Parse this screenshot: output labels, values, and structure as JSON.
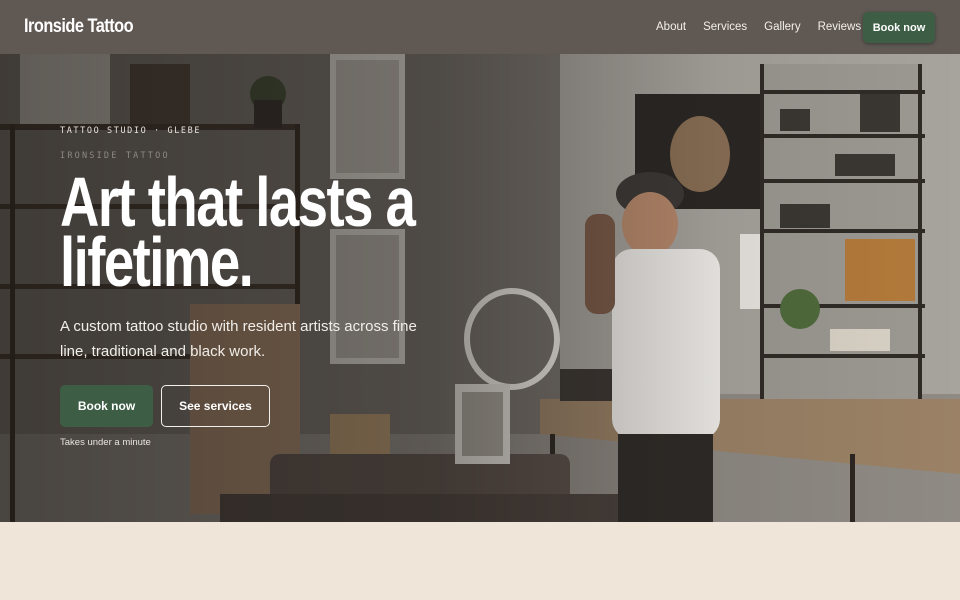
{
  "header": {
    "logo": "Ironside Tattoo",
    "nav": [
      "About",
      "Services",
      "Gallery",
      "Reviews"
    ],
    "cta": "Book now"
  },
  "hero": {
    "eyebrow": "TATTOO STUDIO · GLEBE",
    "eyebrow_sub": "IRONSIDE TATTOO",
    "headline": "Art that lasts a lifetime.",
    "subtext": "A custom tattoo studio with resident artists across fine line, traditional and black work.",
    "primary_button": "Book now",
    "secondary_button": "See services",
    "note": "Takes under a minute"
  },
  "colors": {
    "header_bg": "#5f5853",
    "accent": "#3d5e45",
    "page_bg": "#efe5d8"
  }
}
